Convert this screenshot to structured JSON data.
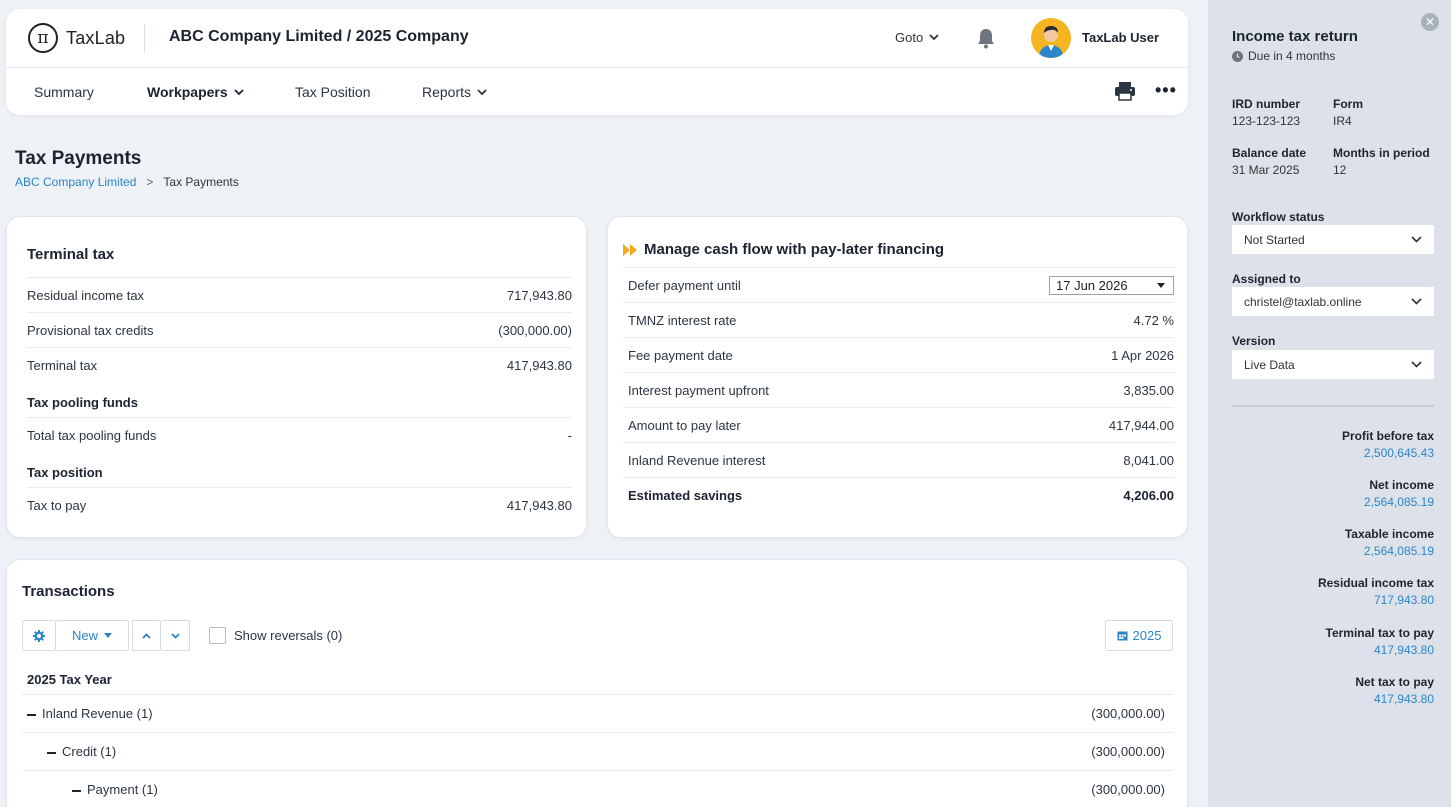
{
  "header": {
    "logo_text": "TaxLab",
    "logo_symbol": "π",
    "company": "ABC Company Limited / 2025 Company",
    "goto_label": "Goto",
    "username": "TaxLab User"
  },
  "nav": {
    "items": [
      {
        "label": "Summary"
      },
      {
        "label": "Workpapers"
      },
      {
        "label": "Tax Position"
      },
      {
        "label": "Reports"
      }
    ],
    "more_label": "•••"
  },
  "page": {
    "title": "Tax Payments",
    "breadcrumb": {
      "parent": "ABC Company Limited",
      "separator": ">",
      "current": "Tax Payments"
    }
  },
  "terminal": {
    "title": "Terminal tax",
    "rows": [
      {
        "label": "Residual income tax",
        "value": "717,943.80"
      },
      {
        "label": "Provisional tax credits",
        "value": "(300,000.00)"
      },
      {
        "label": "Terminal tax",
        "value": "417,943.80"
      }
    ],
    "pooling_head": "Tax pooling funds",
    "pooling_row": {
      "label": "Total tax pooling funds",
      "value": "-"
    },
    "position_head": "Tax position",
    "position_row": {
      "label": "Tax to pay",
      "value": "417,943.80"
    }
  },
  "cashflow": {
    "title": "Manage cash flow with pay-later financing",
    "defer_label": "Defer payment until",
    "defer_value": "17 Jun 2026",
    "rows": [
      {
        "label": "TMNZ interest rate",
        "value": "4.72 %"
      },
      {
        "label": "Fee payment date",
        "value": "1 Apr 2026"
      },
      {
        "label": "Interest payment upfront",
        "value": "3,835.00"
      },
      {
        "label": "Amount to pay later",
        "value": "417,944.00"
      },
      {
        "label": "Inland Revenue interest",
        "value": "8,041.00"
      }
    ],
    "savings_label": "Estimated savings",
    "savings_value": "4,206.00"
  },
  "transactions": {
    "title": "Transactions",
    "new_label": "New",
    "show_reversals": "Show reversals (0)",
    "year_button": "2025",
    "year_head": "2025 Tax Year",
    "tree": [
      {
        "label": "Inland Revenue (1)",
        "value": "(300,000.00)"
      },
      {
        "label": "Credit (1)",
        "value": "(300,000.00)"
      },
      {
        "label": "Payment (1)",
        "value": "(300,000.00)"
      }
    ]
  },
  "side": {
    "title": "Income tax return",
    "due": "Due in 4 months",
    "ird_label": "IRD number",
    "ird_value": "123-123-123",
    "form_label": "Form",
    "form_value": "IR4",
    "balance_label": "Balance date",
    "balance_value": "31 Mar 2025",
    "months_label": "Months in period",
    "months_value": "12",
    "workflow_label": "Workflow status",
    "workflow_value": "Not Started",
    "assigned_label": "Assigned to",
    "assigned_value": "christel@taxlab.online",
    "version_label": "Version",
    "version_value": "Live Data",
    "metrics": [
      {
        "label": "Profit before tax",
        "value": "2,500,645.43"
      },
      {
        "label": "Net income",
        "value": "2,564,085.19"
      },
      {
        "label": "Taxable income",
        "value": "2,564,085.19"
      },
      {
        "label": "Residual income tax",
        "value": "717,943.80"
      },
      {
        "label": "Terminal tax to pay",
        "value": "417,943.80"
      },
      {
        "label": "Net tax to pay",
        "value": "417,943.80"
      }
    ]
  },
  "colors": {
    "accent": "#2a86c8",
    "brand_yellow": "#f4b521",
    "arrow_orange": "#f5a623"
  }
}
